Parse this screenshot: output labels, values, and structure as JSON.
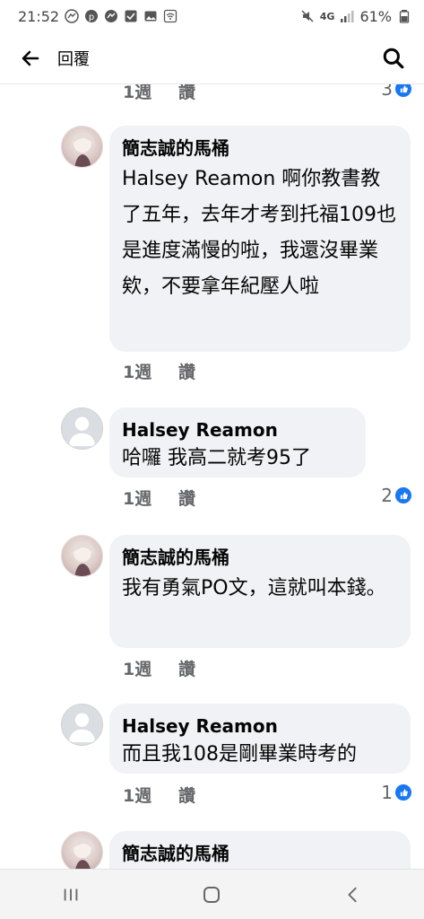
{
  "status_bar": {
    "time": "21:52",
    "network": "4G",
    "battery": "61%",
    "left_icons": [
      "messenger-icon",
      "pinterest-icon",
      "messenger-icon",
      "checkbox-icon",
      "gallery-icon",
      "wifi-icon"
    ],
    "right_icons": [
      "mute-icon",
      "signal-icon",
      "battery-icon"
    ]
  },
  "header": {
    "title": "回覆",
    "back_icon": "back-arrow-icon",
    "search_icon": "search-icon"
  },
  "comments": [
    {
      "id": 0,
      "author": "",
      "text": "",
      "time": "1週",
      "like_label": "讚",
      "reactions": "3"
    },
    {
      "id": 1,
      "author": "簡志誠的馬桶",
      "text": "Halsey Reamon 啊你教書教了五年，去年才考到托福109也是進度滿慢的啦，我還沒畢業欸，不要拿年紀壓人啦",
      "time": "1週",
      "like_label": "讚",
      "reactions": ""
    },
    {
      "id": 2,
      "author": "Halsey Reamon",
      "text": "哈囉 我高二就考95了",
      "time": "1週",
      "like_label": "讚",
      "reactions": "2"
    },
    {
      "id": 3,
      "author": "簡志誠的馬桶",
      "text": "我有勇氣PO文，這就叫本錢。",
      "time": "1週",
      "like_label": "讚",
      "reactions": ""
    },
    {
      "id": 4,
      "author": "Halsey Reamon",
      "text": "而且我108是剛畢業時考的",
      "time": "1週",
      "like_label": "讚",
      "reactions": "1"
    },
    {
      "id": 5,
      "author": "簡志誠的馬桶",
      "text": "",
      "time": "",
      "like_label": "",
      "reactions": ""
    }
  ],
  "nav_bar": {
    "icons": [
      "recent-apps-icon",
      "home-icon",
      "back-icon"
    ]
  },
  "colors": {
    "bubble": "#f0f2f5",
    "like_blue": "#1877f2",
    "meta_gray": "#65676b"
  }
}
